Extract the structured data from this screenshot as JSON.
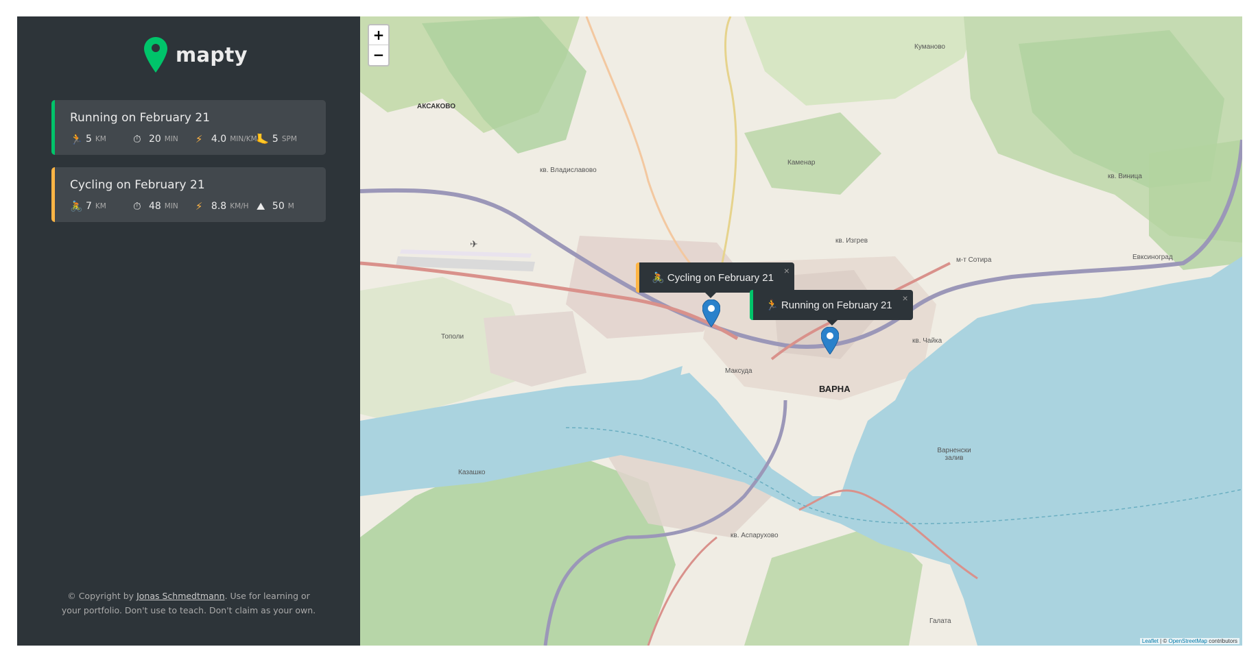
{
  "logo": {
    "text": "mapty"
  },
  "workouts": [
    {
      "type": "running",
      "title": "Running on February 21",
      "details": [
        {
          "icon": "runner-icon",
          "glyph": "🏃",
          "value": "5",
          "unit": "km"
        },
        {
          "icon": "stopwatch-icon",
          "glyph": "⏱",
          "value": "20",
          "unit": "min"
        },
        {
          "icon": "lightning-icon",
          "glyph": "⚡",
          "value": "4.0",
          "unit": "min/km"
        },
        {
          "icon": "foot-icon",
          "glyph": "🦶",
          "value": "5",
          "unit": "spm"
        }
      ]
    },
    {
      "type": "cycling",
      "title": "Cycling on February 21",
      "details": [
        {
          "icon": "cyclist-icon",
          "glyph": "🚴",
          "value": "7",
          "unit": "km"
        },
        {
          "icon": "stopwatch-icon",
          "glyph": "⏱",
          "value": "48",
          "unit": "min"
        },
        {
          "icon": "lightning-icon",
          "glyph": "⚡",
          "value": "8.8",
          "unit": "km/h"
        },
        {
          "icon": "mountain-icon",
          "glyph": "⛰",
          "value": "50",
          "unit": "m"
        }
      ]
    }
  ],
  "copyright": {
    "prefix": "© Copyright by ",
    "author": "Jonas Schmedtmann",
    "suffix": ". Use for learning or your portfolio. Don't use to teach. Don't claim as your own."
  },
  "map": {
    "zoom_in": "+",
    "zoom_out": "−",
    "popups": {
      "cycling": {
        "glyph": "🚴",
        "text": "Cycling on February 21",
        "close": "×"
      },
      "running": {
        "glyph": "🏃",
        "text": "Running on February 21",
        "close": "×"
      }
    },
    "labels": {
      "varna_city": "ВАРНА",
      "aksakovo": "АКСАКОВО",
      "varnenski_zaliv": "Варненски залив",
      "kazashko": "Казашко",
      "tapoli": "Тополи",
      "maksuda": "Максуда",
      "kamenar": "Каменар",
      "kv_vinitsa": "кв. Виница",
      "evksinograd": "Евксиноград",
      "kv_chayka": "кв. Чайка",
      "kv_vladislavovo": "кв. Владиславово",
      "kv_asparuhovo": "кв. Аспарухово",
      "kv_izgrev": "кв. Изгрев",
      "kumanovo": "Куманово",
      "galata": "Галата",
      "m_t_sotira": "м-т Сотира"
    },
    "attribution": {
      "leaflet": "Leaflet",
      "sep": " | © ",
      "osm": "OpenStreetMap",
      "tail": " contributors"
    },
    "colors": {
      "sea": "#aad3df",
      "land": "#f0ede4",
      "forest": "#add19e"
    }
  },
  "colors": {
    "running": "#00c46a",
    "cycling": "#ffb545",
    "sidebar": "#2d3439",
    "card": "#42484d"
  }
}
